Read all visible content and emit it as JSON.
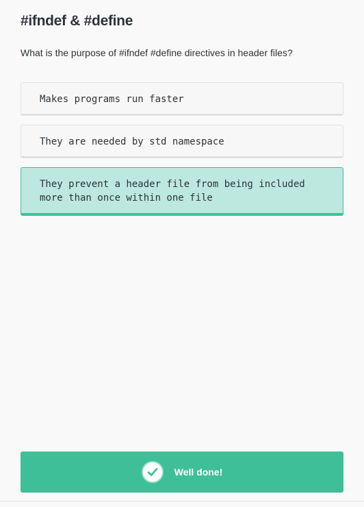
{
  "quiz": {
    "title": "#ifndef & #define",
    "question": "What is the purpose of #ifndef #define directives in header files?",
    "options": [
      {
        "label": "Makes programs run faster",
        "state": "default"
      },
      {
        "label": "They are needed by std namespace",
        "state": "default"
      },
      {
        "label": "They prevent a header file from being included more than once within one file",
        "state": "selected-correct"
      }
    ]
  },
  "feedback": {
    "text": "Well done!",
    "icon": "check-icon"
  },
  "colors": {
    "accent": "#3fbf98",
    "selected_background": "#bce8df",
    "text": "#2d3339",
    "page_background": "#f9f9f9"
  }
}
